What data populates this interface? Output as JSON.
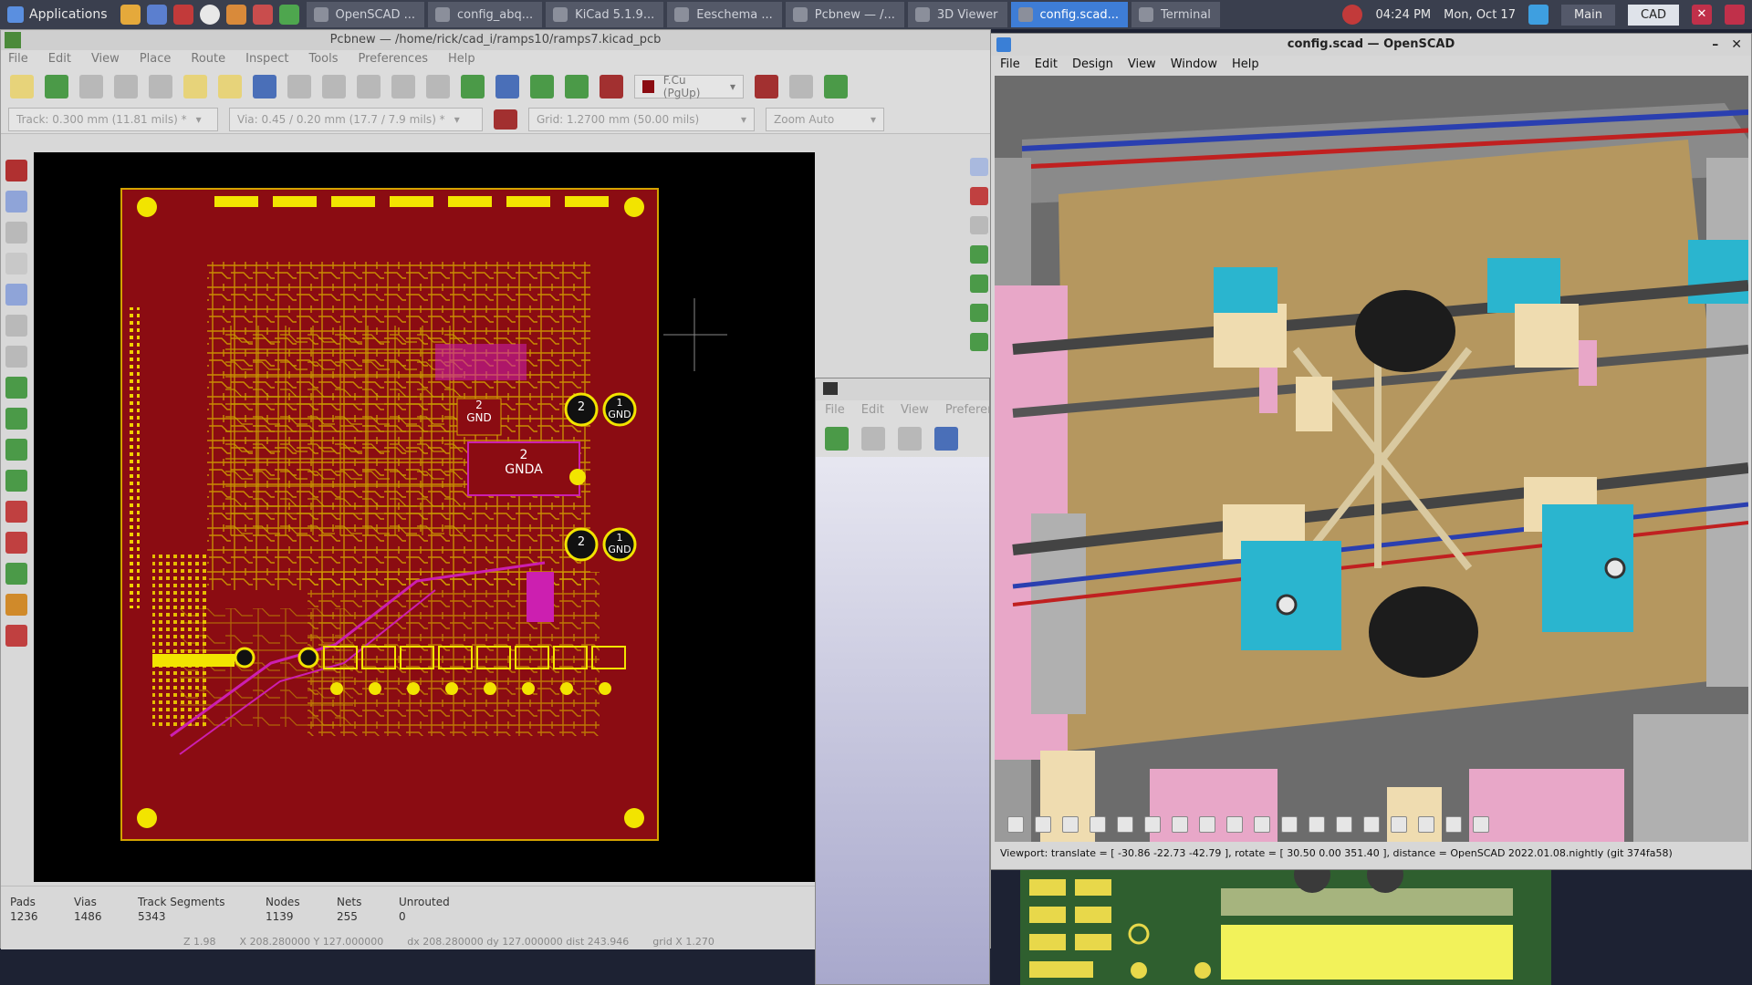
{
  "taskbar": {
    "apps_label": "Applications",
    "tasks": [
      "OpenSCAD ...",
      "config_abq...",
      "KiCad 5.1.9...",
      "Eeschema ...",
      "Pcbnew — /...",
      "3D Viewer",
      "config.scad...",
      "Terminal"
    ],
    "time": "04:24 PM",
    "date": "Mon, Oct 17",
    "workspaces": [
      "Main",
      "CAD"
    ]
  },
  "pcbnew": {
    "title": "Pcbnew — /home/rick/cad_i/ramps10/ramps7.kicad_pcb",
    "menu": [
      "File",
      "Edit",
      "View",
      "Place",
      "Route",
      "Inspect",
      "Tools",
      "Preferences",
      "Help"
    ],
    "layer_select": "F.Cu (PgUp)",
    "track_select": "Track: 0.300 mm (11.81 mils) *",
    "via_select": "Via: 0.45 / 0.20 mm (17.7 / 7.9 mils) *",
    "grid_select": "Grid: 1.2700 mm (50.00 mils)",
    "zoom_select": "Zoom Auto",
    "board_labels": {
      "gnd_box": "2\nGND",
      "gnda_box": "2\nGNDA",
      "cap1_left": "2",
      "cap1_right": "1\nGND",
      "cap2_left": "2",
      "cap2_right": "1\nGND"
    },
    "status": {
      "pads_label": "Pads",
      "pads": "1236",
      "vias_label": "Vias",
      "vias": "1486",
      "segments_label": "Track Segments",
      "segments": "5343",
      "nodes_label": "Nodes",
      "nodes": "1139",
      "nets_label": "Nets",
      "nets": "255",
      "unrouted_label": "Unrouted",
      "unrouted": "0"
    },
    "coords": {
      "z": "Z 1.98",
      "xy": "X 208.280000  Y 127.000000",
      "dxdy": "dx 208.280000  dy 127.000000  dist 243.946",
      "grid": "grid X 1.270"
    }
  },
  "scad": {
    "title": "config.scad — OpenSCAD",
    "menu": [
      "File",
      "Edit",
      "Design",
      "View",
      "Window",
      "Help"
    ],
    "info": "Viewport: translate = [ -30.86 -22.73 -42.79 ], rotate = [ 30.50 0.00 351.40 ], distance = OpenSCAD 2022.01.08.nightly (git 374fa58)"
  },
  "minwin": {
    "menu": [
      "File",
      "Edit",
      "View",
      "Preferen"
    ]
  },
  "colors": {
    "board": "#8b0c12",
    "copper": "#d4a300",
    "scad_plate": "#b5975f",
    "scad_blue": "#2ab5cf",
    "scad_pink": "#e8a7c8"
  }
}
